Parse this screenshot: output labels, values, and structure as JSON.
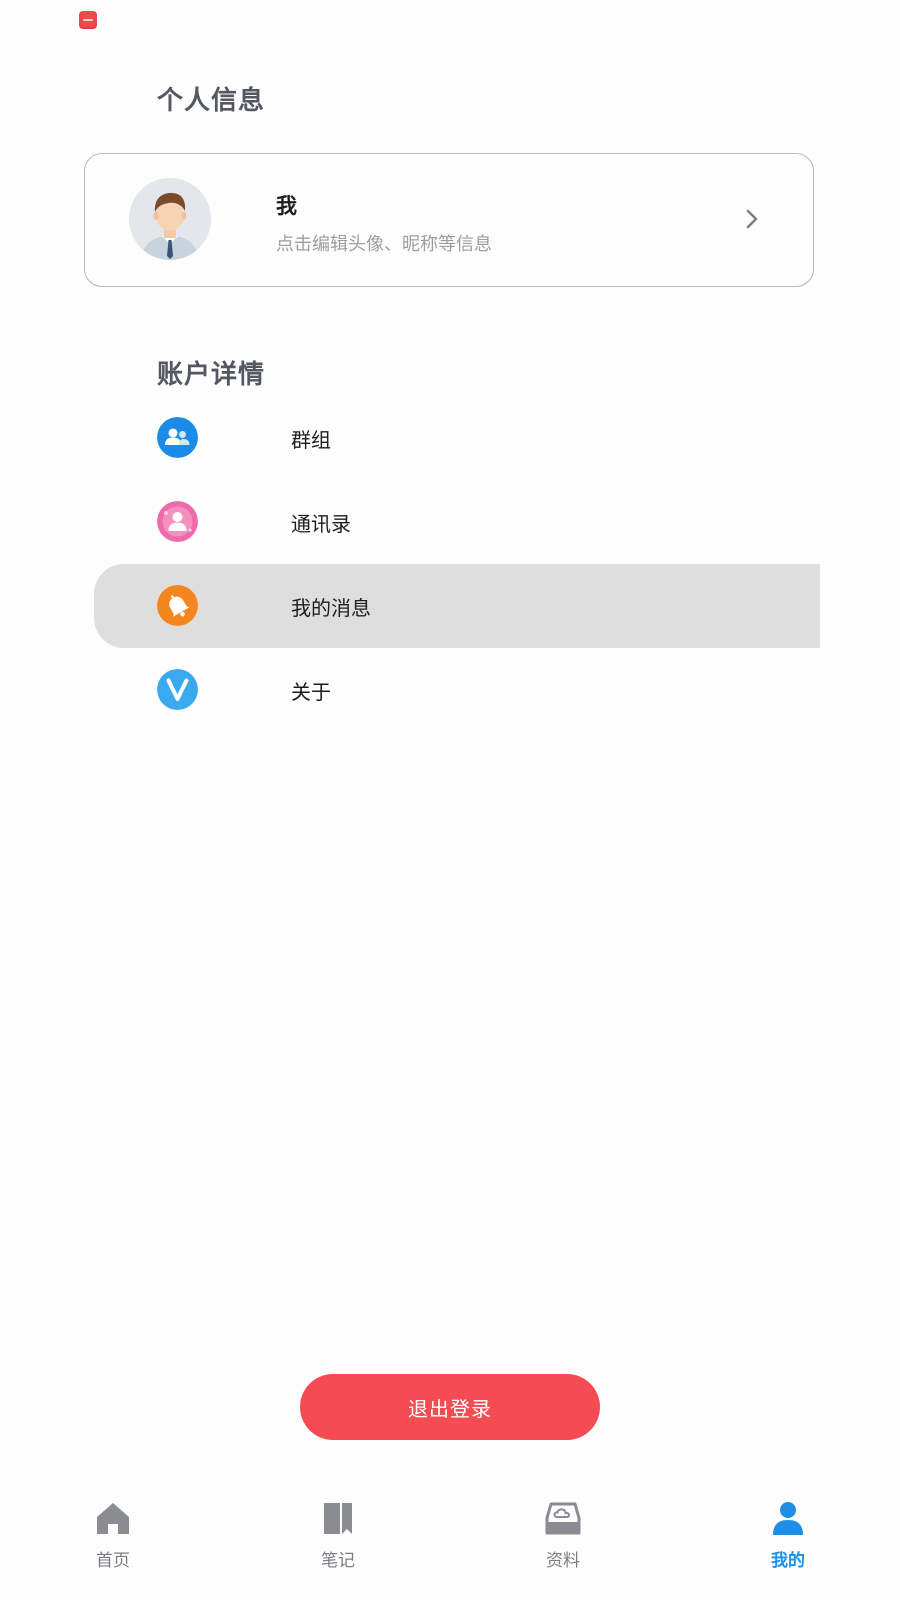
{
  "personal": {
    "section_title": "个人信息",
    "name": "我",
    "subtitle": "点击编辑头像、昵称等信息"
  },
  "account": {
    "section_title": "账户详情",
    "items": [
      {
        "label": "群组",
        "icon": "group-icon",
        "color": "#1a8ce8"
      },
      {
        "label": "通讯录",
        "icon": "contacts-icon",
        "color": "#ee6aa9"
      },
      {
        "label": "我的消息",
        "icon": "bell-icon",
        "color": "#f5851f"
      },
      {
        "label": "关于",
        "icon": "about-v-icon",
        "color": "#3ba9ee"
      }
    ]
  },
  "logout_label": "退出登录",
  "tabs": [
    {
      "label": "首页",
      "icon": "home-icon"
    },
    {
      "label": "笔记",
      "icon": "notebook-icon"
    },
    {
      "label": "资料",
      "icon": "cloud-box-icon"
    },
    {
      "label": "我的",
      "icon": "person-icon",
      "active": true
    }
  ],
  "colors": {
    "accent": "#1e8ee6",
    "logout": "#f54c54",
    "active_row": "#dedede"
  }
}
